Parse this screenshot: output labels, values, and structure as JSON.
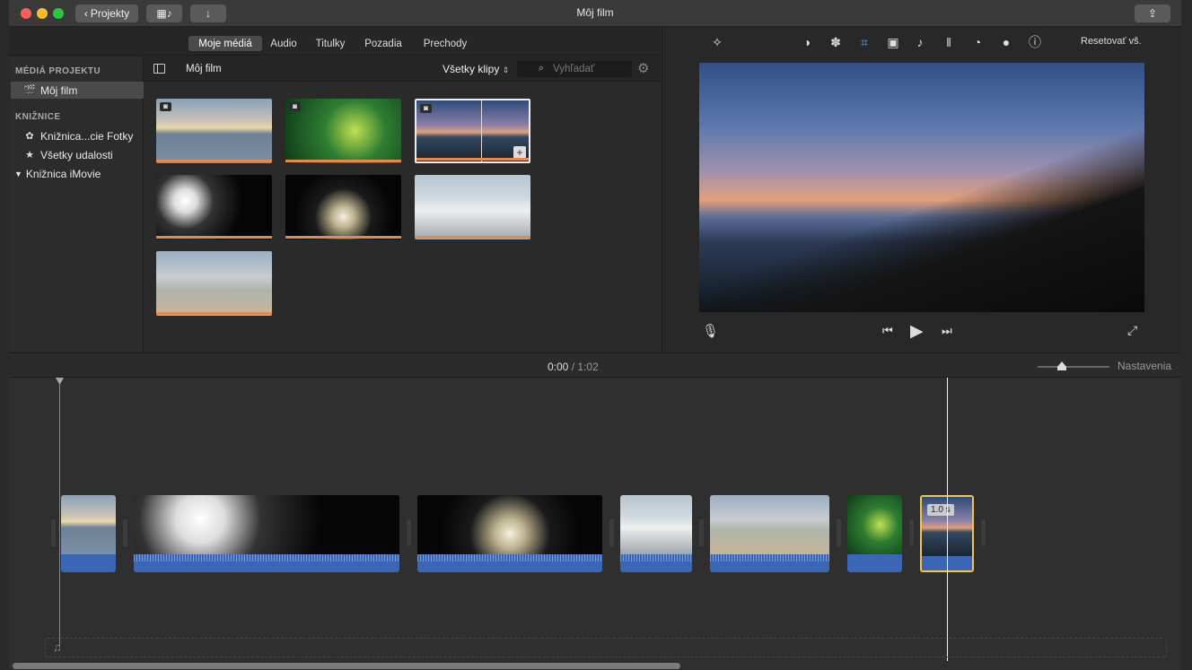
{
  "window": {
    "title": "Môj film"
  },
  "toolbar": {
    "projects_label": "Projekty",
    "back_icon": "chevron-left-icon",
    "media_icon": "film-music-icon",
    "import_icon": "arrow-down-icon",
    "share_icon": "share-icon"
  },
  "tabs": [
    "Moje médiá",
    "Audio",
    "Titulky",
    "Pozadia",
    "Prechody"
  ],
  "sidebar": {
    "project_media_header": "MÉDIÁ PROJEKTU",
    "project_item": "Môj film",
    "libraries_header": "KNIŽNICE",
    "library_items": [
      "Knižnica...cie Fotky",
      "Všetky udalosti"
    ],
    "imovie_library": "Knižnica iMovie"
  },
  "browser": {
    "title": "Môj film",
    "filter": "Všetky klipy",
    "search_placeholder": "Vyhľadať",
    "clips": [
      {
        "thumb": "sunset1",
        "camera": true,
        "selected": false
      },
      {
        "thumb": "concert",
        "camera": true,
        "selected": false
      },
      {
        "thumb": "sunset2",
        "camera": true,
        "selected": true
      },
      {
        "thumb": "fireworks",
        "camera": false,
        "selected": false
      },
      {
        "thumb": "fireworks2",
        "camera": false,
        "selected": false
      },
      {
        "thumb": "waves",
        "camera": false,
        "selected": false
      },
      {
        "thumb": "beach",
        "camera": false,
        "selected": false
      }
    ]
  },
  "viewer": {
    "reset_label": "Resetovať vš.",
    "tools": [
      "magic-wand-icon",
      "color-balance-icon",
      "palette-icon",
      "crop-icon",
      "stabilization-icon",
      "volume-icon",
      "equalizer-icon",
      "speed-icon",
      "filter-icon",
      "info-icon"
    ],
    "active_tool": "crop-icon"
  },
  "timeline": {
    "current_time": "0:00",
    "separator": "/",
    "total_time": "1:02",
    "settings_label": "Nastavenia",
    "selected_clip_duration": "1.0 s"
  },
  "colors": {
    "accent": "#4aa3ff",
    "clip_bar": "#e5894e",
    "audio": "#3b66b5",
    "selection": "#f5c542"
  }
}
